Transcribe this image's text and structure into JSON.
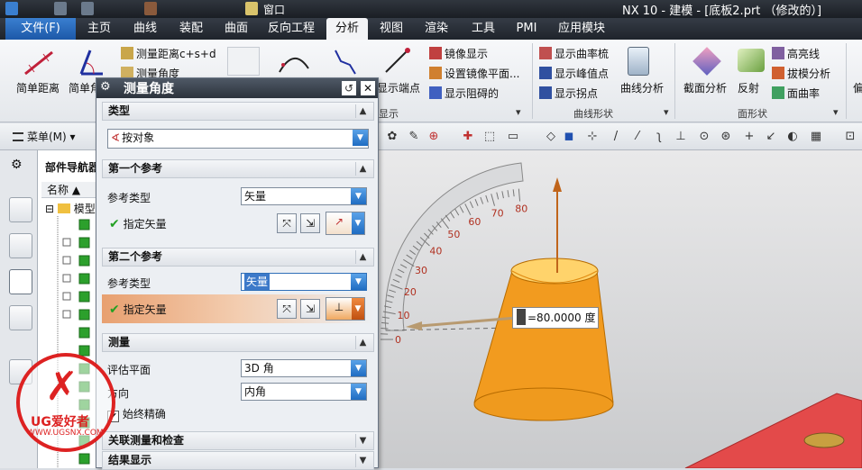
{
  "window": {
    "title": "NX 10 - 建模 - [底板2.prt （修改的）]",
    "window_menu": "窗口"
  },
  "tabs": [
    {
      "label": "文件(F)"
    },
    {
      "label": "主页"
    },
    {
      "label": "曲线"
    },
    {
      "label": "装配"
    },
    {
      "label": "曲面"
    },
    {
      "label": "反向工程"
    },
    {
      "label": "分析"
    },
    {
      "label": "视图"
    },
    {
      "label": "渲染"
    },
    {
      "label": "工具"
    },
    {
      "label": "PMI"
    },
    {
      "label": "应用模块"
    }
  ],
  "ribbon": {
    "simple_distance": "简单距离",
    "simple_angle": "简单角",
    "measure_distance": "测量距离c+s+d",
    "measure_angle": "测量角度",
    "show_endpoints": "显示端点",
    "group_display": "显示",
    "mirror_display": "镜像显示",
    "set_mirror_plane": "设置镜像平面...",
    "show_obstruction": "显示阻碍的",
    "curvature_comb": "显示曲率梳",
    "peak_points": "显示峰值点",
    "inflection_points": "显示拐点",
    "curve_analysis": "曲线分析",
    "group_curve_shape": "曲线形状",
    "section_analysis": "截面分析",
    "reflection": "反射",
    "highlight_lines": "高亮线",
    "draft_analysis": "拔模分析",
    "face_curvature": "面曲率",
    "group_face_shape": "面形状",
    "partial_label": "偏"
  },
  "toolbar": {
    "menu": "菜单(M)"
  },
  "navigator": {
    "title": "部件导航器",
    "column_name": "名称",
    "root": "模型"
  },
  "watermark": {
    "brand": "UG爱好者",
    "url": "WWW.UGSNX.COM"
  },
  "dialog": {
    "title": "测量角度",
    "type_section": "类型",
    "type_value": "按对象",
    "ref1_section": "第一个参考",
    "ref1_type_label": "参考类型",
    "ref1_type_value": "矢量",
    "ref1_specify": "指定矢量",
    "ref2_section": "第二个参考",
    "ref2_type_label": "参考类型",
    "ref2_type_value": "矢量",
    "ref2_specify": "指定矢量",
    "measure_section": "测量",
    "eval_plane_label": "评估平面",
    "eval_plane_value": "3D 角",
    "direction_label": "方向",
    "direction_value": "内角",
    "always_exact": "始终精确",
    "assoc_section": "关联测量和检查",
    "result_section": "结果显示"
  },
  "measurement": {
    "readout": "=80.0000 度",
    "gauge_ticks": [
      "0",
      "10",
      "20",
      "30",
      "40",
      "50",
      "60",
      "70",
      "80"
    ]
  },
  "colors": {
    "accent": "#1c58a8",
    "cone": "#f5a623",
    "arrow": "#c0641a"
  }
}
